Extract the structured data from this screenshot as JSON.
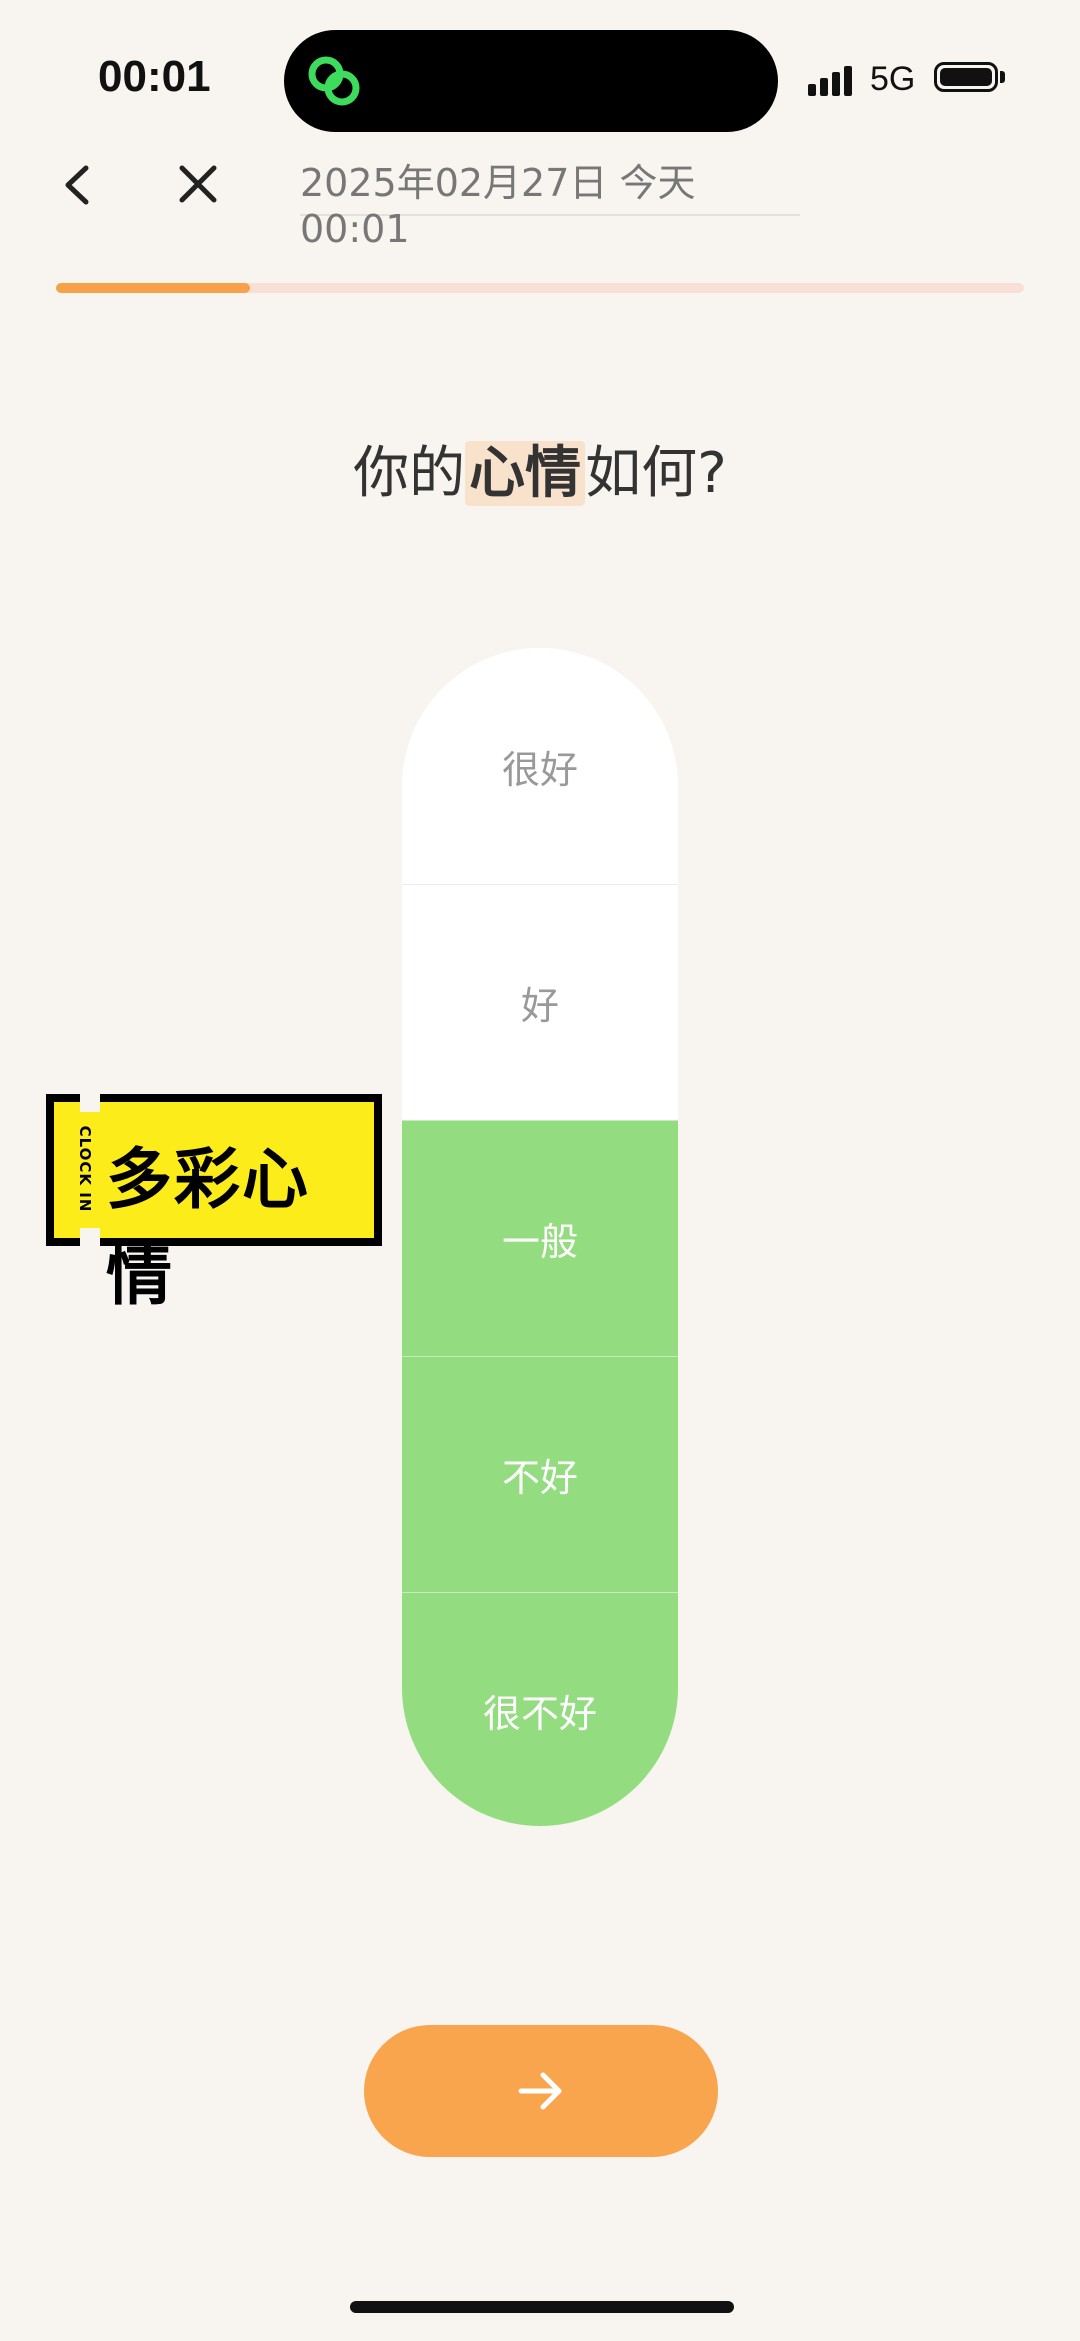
{
  "status_bar": {
    "time": "00:01",
    "network": "5G",
    "app_icon": "link-icon"
  },
  "header": {
    "date_text": "2025年02月27日 今天 00:01",
    "progress_percent": 20
  },
  "question": {
    "prefix": "你的",
    "highlight": "心情",
    "suffix": "如何?"
  },
  "mood": {
    "levels": [
      "很好",
      "好",
      "一般",
      "不好",
      "很不好"
    ],
    "selected": "一般",
    "active_color": "#93dc80"
  },
  "sticker": {
    "side_text": "CLOCK IN",
    "title": "多彩心情"
  },
  "colors": {
    "accent": "#f9a54e",
    "background": "#f8f5f0"
  },
  "icons": {
    "back": "chevron-left-icon",
    "close": "close-icon",
    "next": "arrow-right-icon"
  }
}
